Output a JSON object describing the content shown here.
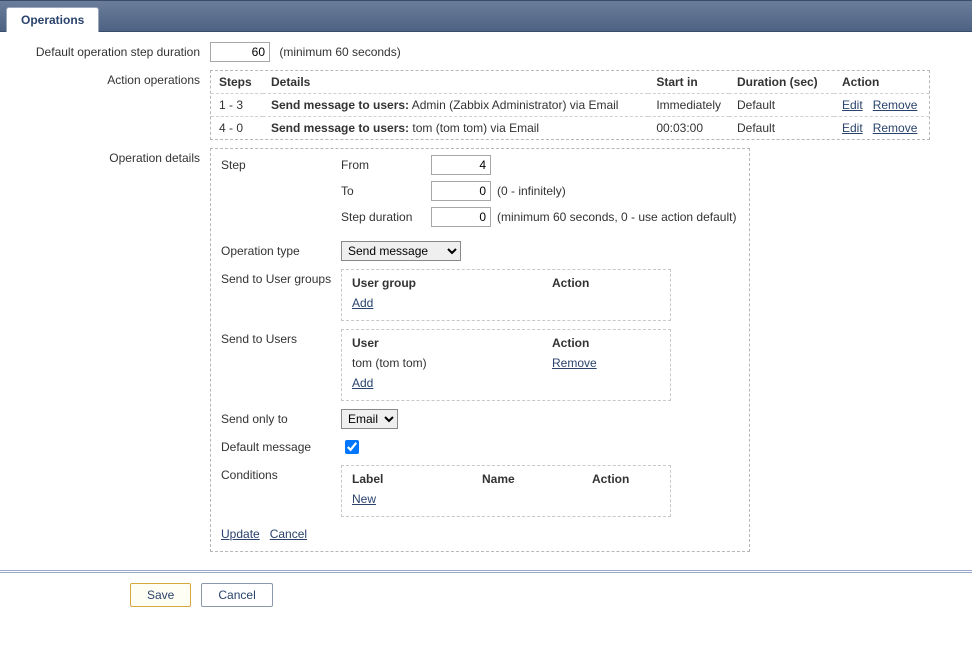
{
  "tab": {
    "label": "Operations"
  },
  "form": {
    "duration_label": "Default operation step duration",
    "duration_value": "60",
    "duration_hint": "(minimum 60 seconds)",
    "actions_label": "Action operations",
    "details_label": "Operation details"
  },
  "ops_table": {
    "headers": {
      "steps": "Steps",
      "details": "Details",
      "start": "Start in",
      "duration": "Duration (sec)",
      "action": "Action"
    },
    "rows": [
      {
        "steps": "1 - 3",
        "details_bold": "Send message to users:",
        "details_rest": " Admin (Zabbix Administrator) via Email",
        "start": "Immediately",
        "duration": "Default",
        "edit": "Edit",
        "remove": "Remove"
      },
      {
        "steps": "4 - 0",
        "details_bold": "Send message to users:",
        "details_rest": " tom (tom tom) via Email",
        "start": "00:03:00",
        "duration": "Default",
        "edit": "Edit",
        "remove": "Remove"
      }
    ]
  },
  "details": {
    "step_label": "Step",
    "from_label": "From",
    "from_value": "4",
    "to_label": "To",
    "to_value": "0",
    "to_hint": "(0 - infinitely)",
    "stepdur_label": "Step duration",
    "stepdur_value": "0",
    "stepdur_hint": "(minimum 60 seconds, 0 - use action default)",
    "optype_label": "Operation type",
    "optype_value": "Send message",
    "groups_label": "Send to User groups",
    "users_label": "Send to Users",
    "only_label": "Send only to",
    "only_value": "Email",
    "defmsg_label": "Default message",
    "cond_label": "Conditions",
    "update": "Update",
    "cancel": "Cancel"
  },
  "groups_box": {
    "h1": "User group",
    "h2": "Action",
    "add": "Add"
  },
  "users_box": {
    "h1": "User",
    "h2": "Action",
    "row_user": "tom (tom tom)",
    "row_action": "Remove",
    "add": "Add"
  },
  "cond_box": {
    "h1": "Label",
    "h2": "Name",
    "h3": "Action",
    "new": "New"
  },
  "footer": {
    "save": "Save",
    "cancel": "Cancel"
  }
}
